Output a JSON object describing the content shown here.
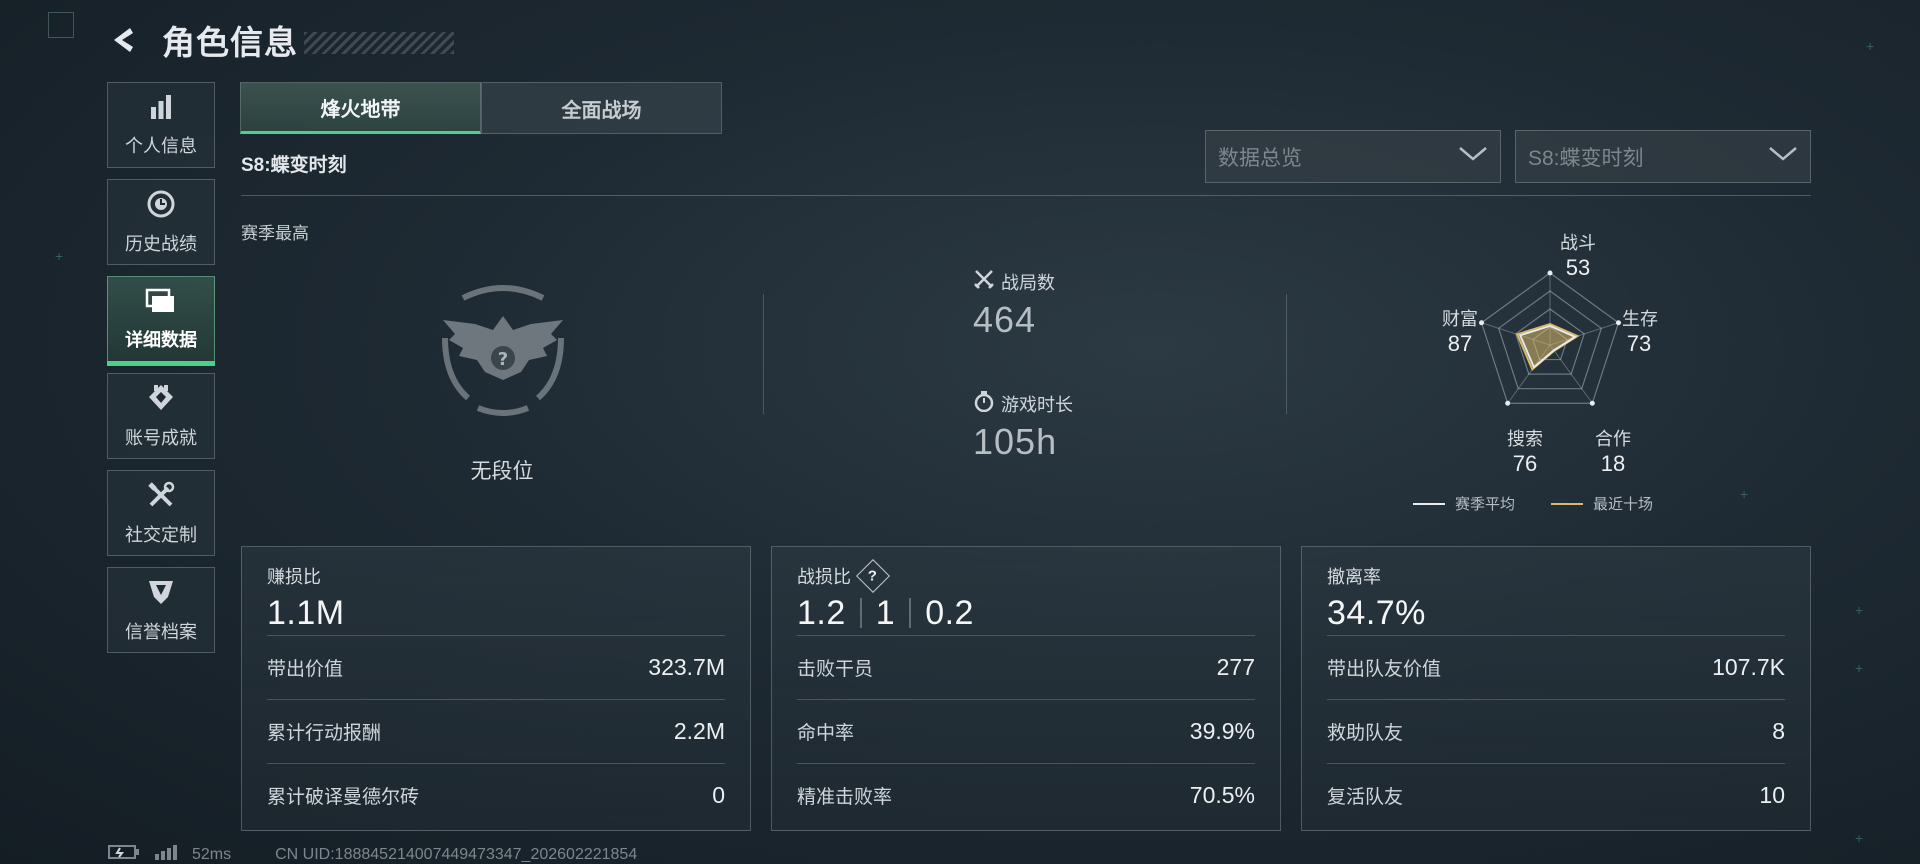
{
  "header": {
    "title": "角色信息"
  },
  "sidebar": {
    "items": [
      {
        "label": "个人信息",
        "icon": "bar-chart-icon"
      },
      {
        "label": "历史战绩",
        "icon": "clock-icon"
      },
      {
        "label": "详细数据",
        "icon": "folder-icon",
        "active": true
      },
      {
        "label": "账号成就",
        "icon": "medal-icon"
      },
      {
        "label": "社交定制",
        "icon": "tools-icon"
      },
      {
        "label": "信誉档案",
        "icon": "shield-badge-icon"
      }
    ]
  },
  "tabs": [
    {
      "label": "烽火地带",
      "active": true
    },
    {
      "label": "全面战场"
    }
  ],
  "season_title": "S8:蝶变时刻",
  "filters": {
    "view": "数据总览",
    "season": "S8:蝶变时刻"
  },
  "season_best": {
    "label": "赛季最高",
    "rank_label": "无段位"
  },
  "stats": {
    "matches_label": "战局数",
    "matches_value": "464",
    "playtime_label": "游戏时长",
    "playtime_value": "105h"
  },
  "radar": {
    "axes": [
      {
        "label": "战斗",
        "value": "53"
      },
      {
        "label": "生存",
        "value": "73"
      },
      {
        "label": "合作",
        "value": "18"
      },
      {
        "label": "搜索",
        "value": "76"
      },
      {
        "label": "财富",
        "value": "87"
      }
    ],
    "legend": [
      {
        "label": "赛季平均",
        "color": "#e8ecee"
      },
      {
        "label": "最近十场",
        "color": "#d9b86a"
      }
    ]
  },
  "cards": {
    "profit": {
      "title": "赚损比",
      "main": "1.1M",
      "rows": [
        {
          "label": "带出价值",
          "value": "323.7M"
        },
        {
          "label": "累计行动报酬",
          "value": "2.2M"
        },
        {
          "label": "累计破译曼德尔砖",
          "value": "0"
        }
      ]
    },
    "combat": {
      "title": "战损比",
      "help": "?",
      "main_parts": [
        "1.2",
        "1",
        "0.2"
      ],
      "rows": [
        {
          "label": "击败干员",
          "value": "277"
        },
        {
          "label": "命中率",
          "value": "39.9%"
        },
        {
          "label": "精准击败率",
          "value": "70.5%"
        }
      ]
    },
    "extract": {
      "title": "撤离率",
      "main": "34.7%",
      "rows": [
        {
          "label": "带出队友价值",
          "value": "107.7K"
        },
        {
          "label": "救助队友",
          "value": "8"
        },
        {
          "label": "复活队友",
          "value": "10"
        }
      ]
    }
  },
  "footer": {
    "ping": "52ms",
    "uid": "CN UID:188845214007449473347_202602221854"
  },
  "colors": {
    "accent": "#4fd08a",
    "recent": "#d9b86a"
  }
}
